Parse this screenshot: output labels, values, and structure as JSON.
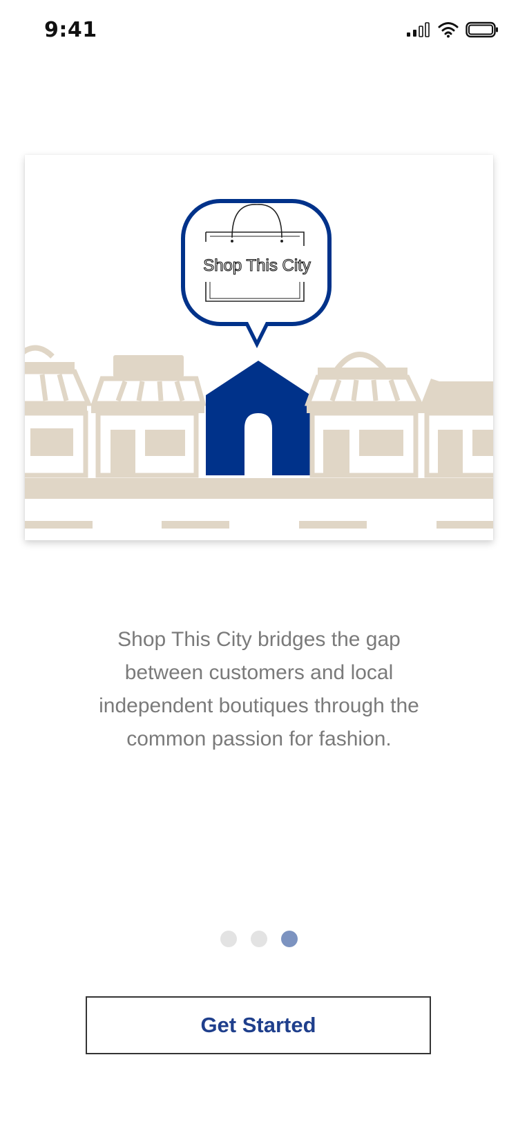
{
  "status_bar": {
    "time": "9:41",
    "icons": [
      "cellular-signal-icon",
      "wifi-icon",
      "battery-icon"
    ]
  },
  "illustration": {
    "logo_text": "Shop This City",
    "colors": {
      "brand_blue": "#00328a",
      "building_beige": "#e0d6c6"
    }
  },
  "onboarding": {
    "description": "Shop This City bridges the gap between customers and local independent boutiques through the common passion for fashion."
  },
  "pager": {
    "total": 3,
    "active_index": 3,
    "active_color": "#7c93c0",
    "inactive_color": "#e3e3e3"
  },
  "cta": {
    "label": "Get Started",
    "color": "#1f3f8c"
  }
}
